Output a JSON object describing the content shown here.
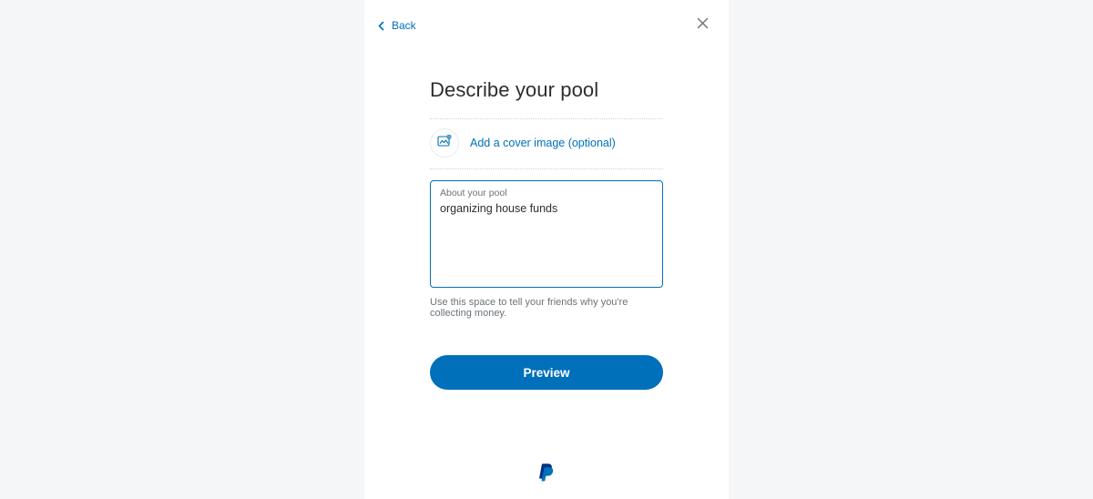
{
  "nav": {
    "back_label": "Back"
  },
  "page": {
    "title": "Describe your pool",
    "cover_link": "Add a cover image (optional)"
  },
  "form": {
    "about_label": "About your pool",
    "about_value": "organizing house funds",
    "helper": "Use this space to tell your friends why you're collecting money."
  },
  "actions": {
    "preview": "Preview"
  },
  "colors": {
    "brand_primary": "#0070ba",
    "brand_dark": "#003087"
  }
}
